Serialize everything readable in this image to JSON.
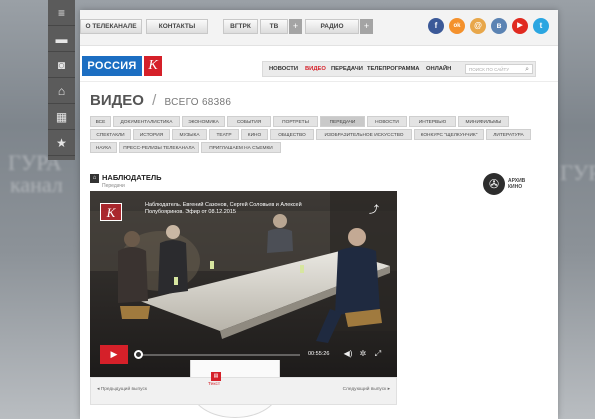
{
  "topbar": {
    "about_label": "О ТЕЛЕКАНАЛЕ",
    "contacts_label": "КОНТАКТЫ",
    "vgtrk_label": "ВГТРК",
    "tv_label": "ТВ",
    "radio_label": "РАДИО",
    "plus": "+",
    "social": [
      {
        "icon": "facebook-icon",
        "glyph": "f",
        "color": "#3b5998"
      },
      {
        "icon": "odnoklassniki-icon",
        "glyph": "ok",
        "color": "#f4912c"
      },
      {
        "icon": "mail-icon",
        "glyph": "@",
        "color": "#e8a74a"
      },
      {
        "icon": "vk-icon",
        "glyph": "в",
        "color": "#5b83b3"
      },
      {
        "icon": "youtube-icon",
        "glyph": "▶",
        "color": "#e02a20"
      },
      {
        "icon": "twitter-icon",
        "glyph": "t",
        "color": "#2ba6e1"
      }
    ]
  },
  "logo": {
    "text": "РОССИЯ",
    "k": "К"
  },
  "mainnav": {
    "items": [
      "НОВОСТИ",
      "ВИДЕО",
      "ПЕРЕДАЧИ",
      "ТЕЛЕПРОГРАММА",
      "ОНЛАЙН"
    ],
    "search_placeholder": "ПОИСК ПО САЙТУ"
  },
  "heading": {
    "title": "ВИДЕО",
    "separator": "/",
    "total": "ВСЕГО 68386"
  },
  "tags": {
    "row1": [
      "ВСЕ",
      "ДОКУМЕНТАЛИСТИКА",
      "ЭКОНОМИКА",
      "СОБЫТИЯ",
      "ПОРТРЕТЫ",
      "ПЕРЕДАЧИ",
      "НОВОСТИ",
      "ИНТЕРВЬЮ",
      "МИНИФИЛЬМЫ"
    ],
    "row2": [
      "СПЕКТАКЛИ",
      "ИСТОРИЯ",
      "МУЗЫКА",
      "ТЕАТР",
      "КИНО",
      "ОБЩЕСТВО",
      "ИЗОБРАЗИТЕЛЬНОЕ ИСКУССТВО",
      "КОНКУРС \"ЩЕЛКУНЧИК\"",
      "ЛИТЕРАТУРА"
    ],
    "row3": [
      "НАУКА",
      "ПРЕСС-РЕЛИЗЫ ТЕЛЕКАНАЛА",
      "ПРИГЛАШАЕМ НА СЪЕМКИ"
    ],
    "active": "ПЕРЕДАЧИ"
  },
  "program": {
    "title": "НАБЛЮДАТЕЛЬ",
    "subtitle": "Передачи"
  },
  "archive": {
    "line1": "АРХИВ",
    "line2": "КИНО"
  },
  "player": {
    "title": "Наблюдатель. Евгений Сазонов, Сергей Соловьев и Алексей Полубояринов. Эфир от 08.12.2015",
    "duration": "00:55:26",
    "progress": 0.0,
    "k": "К"
  },
  "bottom_nav": {
    "prev": "◂  Предыдущий выпуск",
    "next": "Следующий выпуск  ▸",
    "text_label": "Текст"
  },
  "backdrop": {
    "words": [
      "канал",
      "ГУРА"
    ]
  }
}
